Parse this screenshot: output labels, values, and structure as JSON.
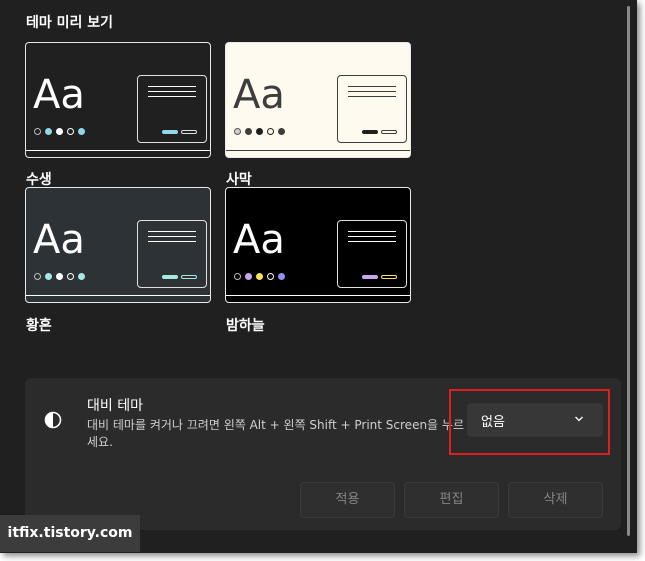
{
  "section_title": "테마 미리 보기",
  "themes": [
    {
      "label": "수생",
      "sample": "Aa",
      "bg": "#202020",
      "text": "#ffffff",
      "accent": "#8fd8ea"
    },
    {
      "label": "사막",
      "sample": "Aa",
      "bg": "#fffaef",
      "text": "#3d3d3d",
      "accent": "#202020"
    },
    {
      "label": "황혼",
      "sample": "Aa",
      "bg": "#2d3236",
      "text": "#ffffff",
      "accent": "#a6e9e0"
    },
    {
      "label": "밤하늘",
      "sample": "Aa",
      "bg": "#000000",
      "text": "#ffffff",
      "accent": "#c8a6f0"
    }
  ],
  "contrast": {
    "title": "대비 테마",
    "description": "대비 테마를 켜거나 끄려면 왼쪽 Alt + 왼쪽 Shift + Print Screen을 누르세요.",
    "dropdown_value": "없음",
    "icon": "contrast-icon"
  },
  "actions": {
    "apply": "적용",
    "edit": "편집",
    "delete": "삭제"
  },
  "watermark": "itfix.tistory.com",
  "colors": {
    "highlight_frame": "#e0201e",
    "window_bg": "#202020",
    "card_bg": "#2b2b2b"
  }
}
